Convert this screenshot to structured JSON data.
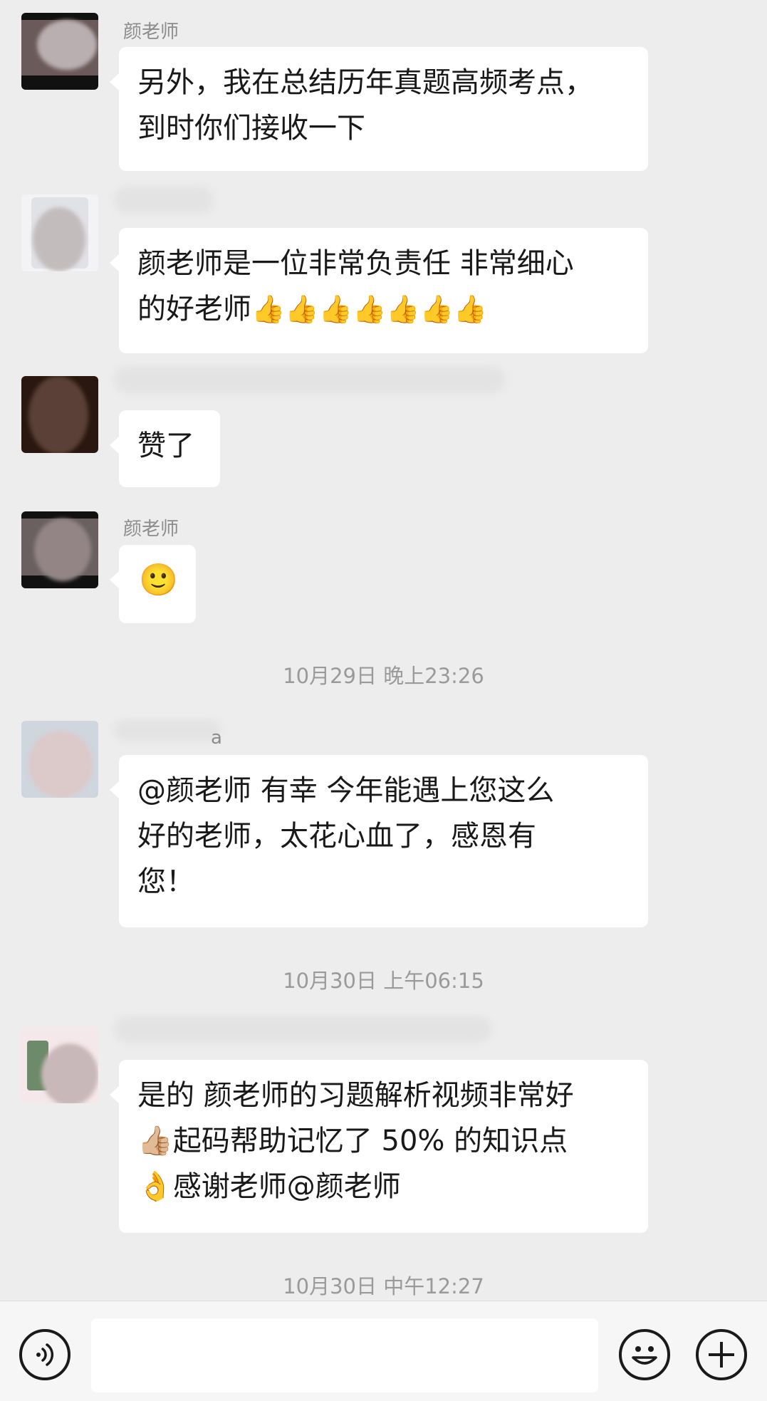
{
  "messages": [
    {
      "sender": "颜老师",
      "lines": [
        "另外，我在总结历年真题高频考点，",
        "到时你们接收一下"
      ]
    },
    {
      "sender": "",
      "lines": [
        "颜老师是一位非常负责任 非常细心",
        "的好老师"
      ],
      "emoji": "👍👍👍👍👍👍👍"
    },
    {
      "sender": "",
      "lines": [
        "赞了"
      ]
    },
    {
      "sender": "颜老师",
      "emoji": "🙂"
    },
    {
      "sender": "a",
      "lines": [
        "@颜老师  有幸 今年能遇上您这么",
        "好的老师，太花心血了，感恩有",
        "您！"
      ]
    },
    {
      "sender": "",
      "line1": "是的 颜老师的习题解析视频非常好",
      "line2_emoji": "👍🏼",
      "line2": "起码帮助记忆了 50% 的知识点",
      "line3_emoji": "👌",
      "line3": "感谢老师@颜老师"
    }
  ],
  "timestamps": [
    "10月29日 晚上23:26",
    "10月30日 上午06:15",
    "10月30日 中午12:27"
  ],
  "input_bar": {
    "voice_icon": "voice-icon",
    "emoji_icon": "smiley-icon",
    "plus_icon": "plus-icon",
    "text_value": ""
  }
}
